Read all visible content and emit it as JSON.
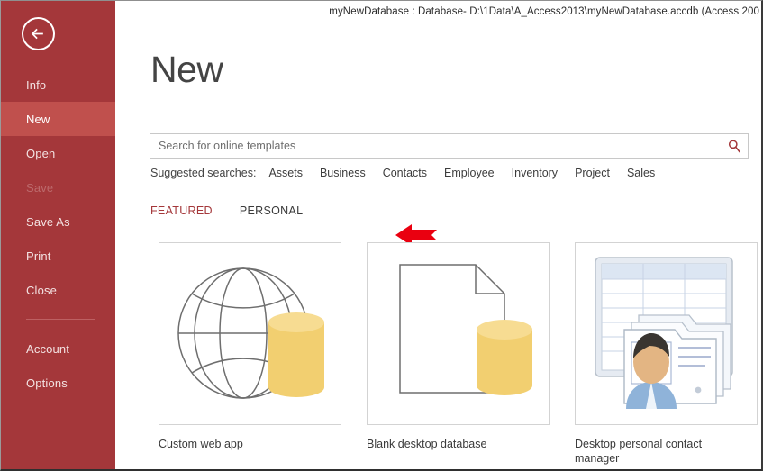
{
  "window": {
    "title": "myNewDatabase : Database- D:\\1Data\\A_Access2013\\myNewDatabase.accdb (Access 200"
  },
  "sidebar": {
    "back_icon": "back-arrow-icon",
    "items": [
      {
        "label": "Info",
        "state": "normal"
      },
      {
        "label": "New",
        "state": "selected"
      },
      {
        "label": "Open",
        "state": "normal"
      },
      {
        "label": "Save",
        "state": "disabled"
      },
      {
        "label": "Save As",
        "state": "normal"
      },
      {
        "label": "Print",
        "state": "normal"
      },
      {
        "label": "Close",
        "state": "normal"
      },
      {
        "label": "Account",
        "state": "normal"
      },
      {
        "label": "Options",
        "state": "normal"
      }
    ],
    "colors": {
      "background": "#a4373a",
      "selected": "#c0504d",
      "text": "#f3e2e2",
      "disabled_text": "#bc6a6c"
    }
  },
  "page": {
    "title": "New"
  },
  "search": {
    "placeholder": "Search for online templates",
    "value": "",
    "icon": "search-icon",
    "icon_color": "#a4373a"
  },
  "suggested": {
    "label": "Suggested searches:",
    "terms": [
      "Assets",
      "Business",
      "Contacts",
      "Employee",
      "Inventory",
      "Project",
      "Sales"
    ]
  },
  "tabs": [
    {
      "label": "FEATURED",
      "active": true
    },
    {
      "label": "PERSONAL",
      "active": false
    }
  ],
  "annotation": {
    "shape": "left-arrow",
    "color": "#ea0010"
  },
  "templates": [
    {
      "name": "Custom web app",
      "icon": "globe-database-icon"
    },
    {
      "name": "Blank desktop database",
      "icon": "page-database-icon"
    },
    {
      "name": "Desktop personal contact manager",
      "icon": "contact-manager-icon"
    }
  ],
  "colors": {
    "cylinder": "#f2cf70",
    "cylinder_top": "#f7dc92",
    "outline": "#6e6e6e",
    "accent_red": "#a4373a"
  }
}
